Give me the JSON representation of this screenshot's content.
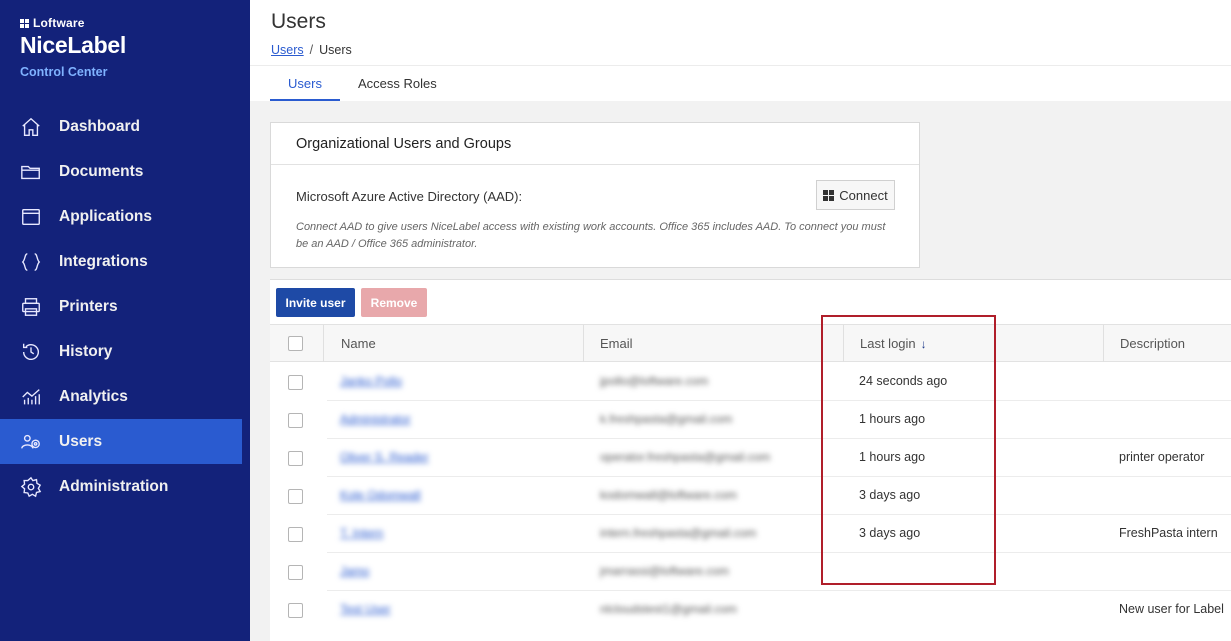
{
  "brand": {
    "company": "Loftware",
    "product": "NiceLabel",
    "subtitle": "Control Center"
  },
  "sidebar": {
    "items": [
      {
        "label": "Dashboard",
        "icon": "home-icon",
        "active": false
      },
      {
        "label": "Documents",
        "icon": "folder-icon",
        "active": false
      },
      {
        "label": "Applications",
        "icon": "window-icon",
        "active": false
      },
      {
        "label": "Integrations",
        "icon": "braces-icon",
        "active": false
      },
      {
        "label": "Printers",
        "icon": "printer-icon",
        "active": false
      },
      {
        "label": "History",
        "icon": "history-icon",
        "active": false
      },
      {
        "label": "Analytics",
        "icon": "analytics-icon",
        "active": false
      },
      {
        "label": "Users",
        "icon": "users-icon",
        "active": true
      },
      {
        "label": "Administration",
        "icon": "gear-icon",
        "active": false
      }
    ]
  },
  "header": {
    "title": "Users",
    "breadcrumb": {
      "link": "Users",
      "separator": "/",
      "current": "Users"
    },
    "tabs": [
      {
        "label": "Users",
        "active": true
      },
      {
        "label": "Access Roles",
        "active": false
      }
    ]
  },
  "aad_card": {
    "title": "Organizational Users and Groups",
    "label": "Microsoft Azure Active Directory (AAD):",
    "connect_label": "Connect",
    "hint": "Connect AAD to give users NiceLabel access with existing work accounts. Office 365 includes AAD. To connect you must be an AAD / Office 365 administrator."
  },
  "toolbar": {
    "invite_label": "Invite user",
    "remove_label": "Remove"
  },
  "table": {
    "columns": {
      "name": "Name",
      "email": "Email",
      "last_login": "Last login",
      "sort_indicator": "↓",
      "description": "Description"
    },
    "rows": [
      {
        "name": "Janko Pollo",
        "email": "jpollo@loftware.com",
        "last_login": "24 seconds ago",
        "description": ""
      },
      {
        "name": "Administrator",
        "email": "k.freshpasta@gmail.com",
        "last_login": "1 hours ago",
        "description": ""
      },
      {
        "name": "Oliver S. Reader",
        "email": "operator.freshpasta@gmail.com",
        "last_login": "1 hours ago",
        "description": "printer operator"
      },
      {
        "name": "Kole Odomwall",
        "email": "kodomwall@loftware.com",
        "last_login": "3 days ago",
        "description": ""
      },
      {
        "name": "T. Intern",
        "email": "intern.freshpasta@gmail.com",
        "last_login": "3 days ago",
        "description": "FreshPasta intern"
      },
      {
        "name": "Jamo",
        "email": "jmarrassi@loftware.com",
        "last_login": "",
        "description": ""
      },
      {
        "name": "Test User",
        "email": "nlcloudstest1@gmail.com",
        "last_login": "",
        "description": "New user for Label"
      }
    ]
  },
  "colors": {
    "sidebar_bg": "#13227a",
    "sidebar_active": "#2a5bd0",
    "primary_button": "#1e4aa6",
    "disabled_button": "#e8a8ab",
    "highlight_border": "#b01e2a"
  }
}
